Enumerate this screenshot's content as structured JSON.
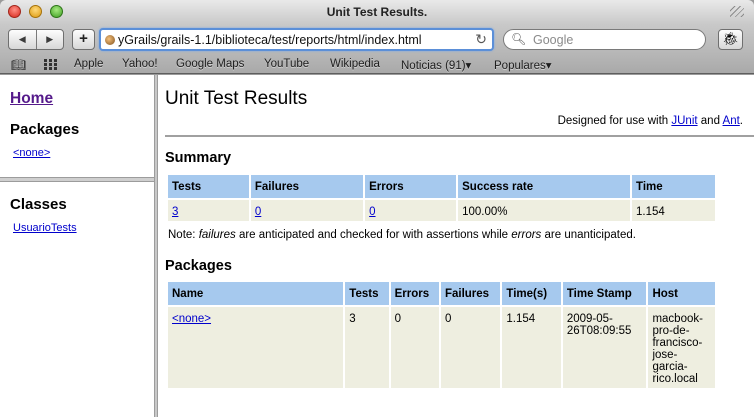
{
  "window": {
    "title": "Unit Test Results."
  },
  "toolbar": {
    "back_icon": "back-arrow-icon",
    "forward_icon": "forward-arrow-icon",
    "add_label": "+",
    "url": "yGrails/grails-1.1/biblioteca/test/reports/html/index.html",
    "search_placeholder": "Google"
  },
  "bookmarks": {
    "items": [
      "Apple",
      "Yahoo!",
      "Google Maps",
      "YouTube",
      "Wikipedia",
      "Noticias (91)▾",
      "Populares▾"
    ]
  },
  "left_frame": {
    "home_label": "Home",
    "packages_heading": "Packages",
    "packages": [
      "<none>"
    ],
    "classes_heading": "Classes",
    "classes": [
      "UsuarioTests"
    ]
  },
  "main": {
    "title": "Unit Test Results",
    "designed_prefix": "Designed for use with ",
    "junit_link": "JUnit",
    "and_text": " and ",
    "ant_link": "Ant",
    "period": ".",
    "summary": {
      "heading": "Summary",
      "headers": [
        "Tests",
        "Failures",
        "Errors",
        "Success rate",
        "Time"
      ],
      "row": {
        "tests": "3",
        "failures": "0",
        "errors": "0",
        "success_rate": "100.00%",
        "time": "1.154"
      }
    },
    "note": {
      "prefix": "Note: ",
      "failures_word": "failures",
      "middle": " are anticipated and checked for with assertions while ",
      "errors_word": "errors",
      "suffix": " are unanticipated."
    },
    "packages": {
      "heading": "Packages",
      "headers": [
        "Name",
        "Tests",
        "Errors",
        "Failures",
        "Time(s)",
        "Time Stamp",
        "Host"
      ],
      "row": {
        "name": "<none>",
        "tests": "3",
        "errors": "0",
        "failures": "0",
        "time": "1.154",
        "timestamp_lines": [
          "2009-05-",
          "26T08:09:55"
        ],
        "host_lines": [
          "macbook-",
          "pro-de-",
          "francisco-",
          "jose-",
          "garcia-",
          "rico.local"
        ]
      }
    }
  }
}
